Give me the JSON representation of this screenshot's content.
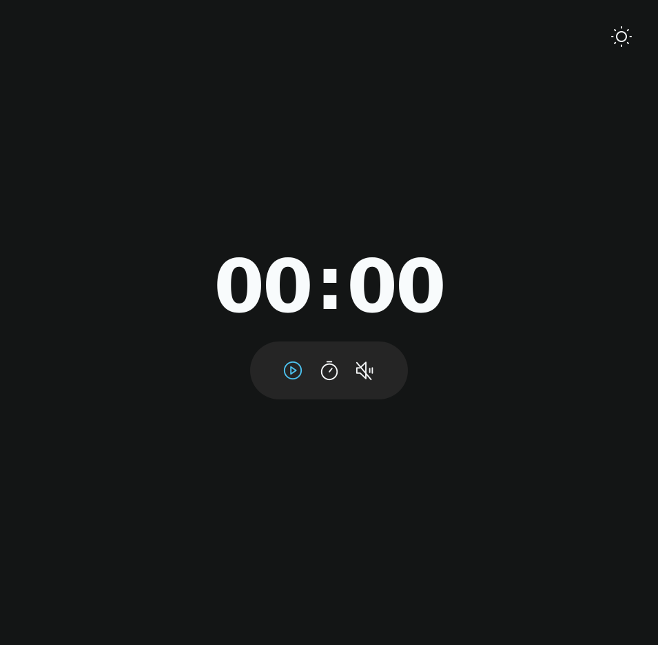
{
  "timer": {
    "minutes": "00",
    "separator": ":",
    "seconds": "00"
  },
  "icons": {
    "theme_toggle": "sun-icon",
    "play": "play-circle-icon",
    "timer": "stopwatch-icon",
    "sound": "speaker-muted-icon"
  },
  "colors": {
    "background": "#131515",
    "control_bar": "#252525",
    "digits": "#f8fbfc",
    "accent": "#4cc3f0",
    "icon": "#f5f7f8"
  }
}
